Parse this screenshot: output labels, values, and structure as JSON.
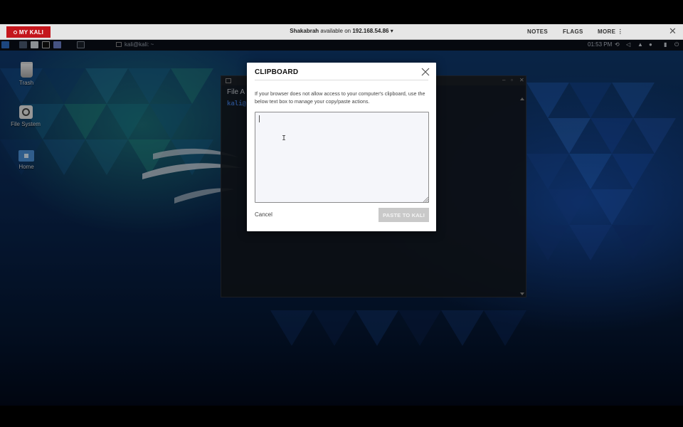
{
  "topbar": {
    "mykali_label": "MY KALI",
    "status_prefix": "Shakabrah",
    "status_middle": "available on",
    "status_ip": "192.168.54.86",
    "status_caret": "▾",
    "nav": [
      "NOTES",
      "FLAGS",
      "MORE ⋮"
    ],
    "close_glyph": "✕",
    "accent_color": "#c4161c"
  },
  "panel": {
    "terminal_label": "kali@kali: ~",
    "clock": "01:53 PM"
  },
  "desktop_icons": [
    {
      "label": "Trash",
      "icon": "trash-icon"
    },
    {
      "label": "File System",
      "icon": "file-system-icon"
    },
    {
      "label": "Home",
      "icon": "home-folder-icon"
    }
  ],
  "terminal": {
    "menu": "File  A",
    "prompt": "kali@"
  },
  "modal": {
    "title": "CLIPBOARD",
    "description": "If your browser does not allow access to your computer's clipboard, use the below text box to manage your copy/paste actions.",
    "textarea_value": "",
    "cancel_label": "Cancel",
    "paste_label": "PASTE TO KALI"
  }
}
